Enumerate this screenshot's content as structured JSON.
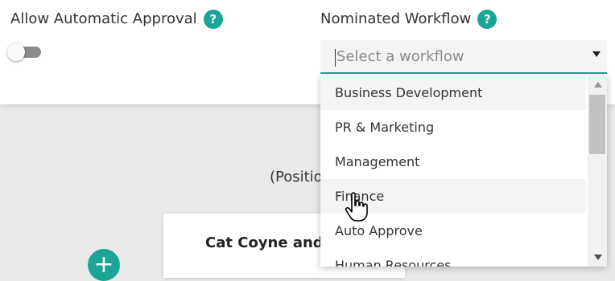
{
  "auto_approval": {
    "label": "Allow Automatic Approval",
    "help_icon": "?",
    "toggle_state": "off"
  },
  "workflow": {
    "label": "Nominated Workflow",
    "help_icon": "?",
    "placeholder": "Select a workflow",
    "options": [
      "Business Development",
      "PR & Marketing",
      "Management",
      "Finance",
      "Auto Approve",
      "Human Resources"
    ]
  },
  "background": {
    "position_text": "(Positio",
    "card_title": "Cat Coyne and ...",
    "add_icon": "+"
  },
  "colors": {
    "accent": "#1aa596",
    "option_highlight": "#f4f4f4"
  }
}
